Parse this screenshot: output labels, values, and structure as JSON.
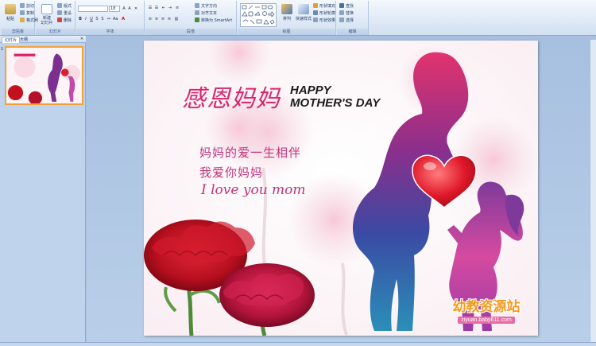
{
  "ribbon": {
    "clipboard": {
      "label": "剪贴板",
      "paste": "粘贴",
      "cut": "剪切",
      "copy": "复制",
      "painter": "格式刷"
    },
    "slides": {
      "label": "幻灯片",
      "new_slide": "新建\n幻灯片",
      "layout": "版式",
      "reset": "重设",
      "delete": "删除"
    },
    "font": {
      "label": "字体",
      "size": "18"
    },
    "paragraph": {
      "label": "段落",
      "text_dir": "文字方向",
      "align_text": "对齐文本",
      "smartart": "转换为 SmartArt"
    },
    "drawing": {
      "label": "绘图",
      "arrange": "排列",
      "quick_styles": "快速样式",
      "fill": "形状填充",
      "outline": "形状轮廓",
      "effects": "形状效果"
    },
    "editing": {
      "label": "编辑",
      "find": "查找",
      "replace": "替换",
      "select": "选择"
    }
  },
  "left_pane": {
    "tab_slides": "幻灯片",
    "tab_outline": "大纲",
    "thumb_number": "1"
  },
  "slide": {
    "title_cn": "感恩妈妈",
    "title_en_1": "HAPPY",
    "title_en_2": "MOTHER'S DAY",
    "line1": "妈妈的爱一生相伴",
    "line2": "我爱你妈妈",
    "line3": "I love you mom",
    "brand": "幼教资源站",
    "brand_url": "ziyuan.baby611.com"
  },
  "colors": {
    "title": "#d9266e",
    "script": "#c2337a",
    "accent": "#f3a13a"
  }
}
